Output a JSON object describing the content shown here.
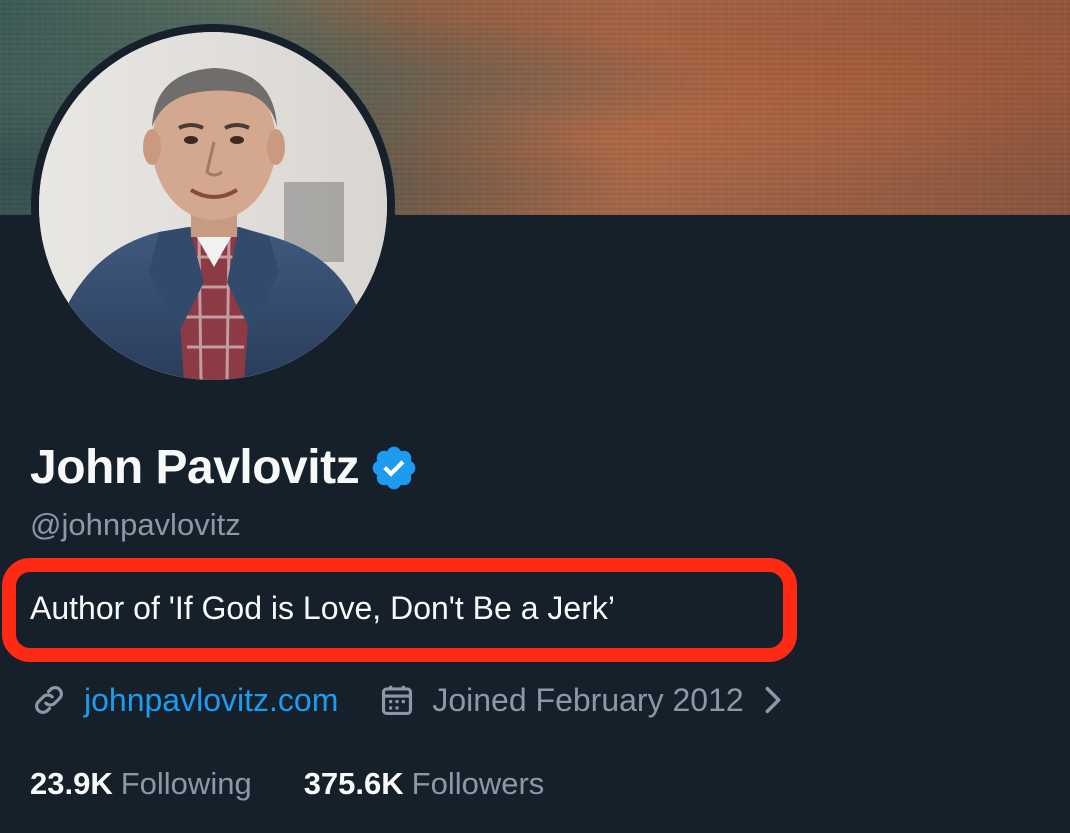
{
  "profile": {
    "display_name": "John Pavlovitz",
    "handle": "@johnpavlovitz",
    "bio": "Author of 'If God is Love, Don't Be a Jerk’",
    "website": "johnpavlovitz.com",
    "joined": "Joined February 2012"
  },
  "stats": {
    "following_count": "23.9K",
    "following_label": "Following",
    "followers_count": "375.6K",
    "followers_label": "Followers"
  },
  "colors": {
    "background": "#15202b",
    "accent": "#1d9bf0",
    "muted": "#8b98a5",
    "highlight": "#ff2a13"
  },
  "icons": {
    "verified": "verified-badge-icon",
    "link": "link-icon",
    "calendar": "calendar-icon",
    "chevron": "chevron-right-icon"
  }
}
